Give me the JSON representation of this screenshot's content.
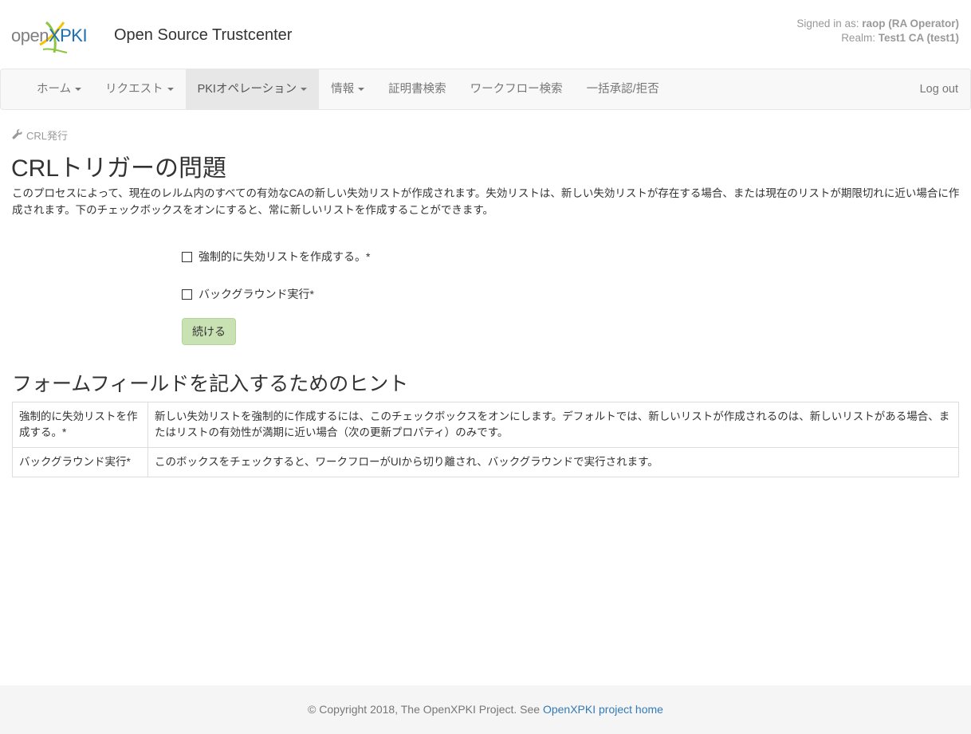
{
  "header": {
    "logo": {
      "part1": "open",
      "part2": "XPKI"
    },
    "site_title": "Open Source Trustcenter",
    "user": {
      "signed_in_label": "Signed in as:",
      "signed_in_value": "raop (RA Operator)",
      "realm_label": "Realm:",
      "realm_value": "Test1 CA (test1)"
    }
  },
  "nav": {
    "items": [
      {
        "label": "ホーム",
        "dropdown": true
      },
      {
        "label": "リクエスト",
        "dropdown": true
      },
      {
        "label": "PKIオペレーション",
        "dropdown": true,
        "active": true
      },
      {
        "label": "情報",
        "dropdown": true
      },
      {
        "label": "証明書検索",
        "dropdown": false
      },
      {
        "label": "ワークフロー検索",
        "dropdown": false
      },
      {
        "label": "一括承認/拒否",
        "dropdown": false
      }
    ],
    "logout": "Log out"
  },
  "breadcrumb": {
    "icon": "wrench-icon",
    "label": "CRL発行"
  },
  "page": {
    "title": "CRLトリガーの問題",
    "description": "このプロセスによって、現在のレルム内のすべての有効なCAの新しい失効リストが作成されます。失効リストは、新しい失効リストが存在する場合、または現在のリストが期限切れに近い場合に作成されます。下のチェックボックスをオンにすると、常に新しいリストを作成することができます。"
  },
  "form": {
    "force_label": "強制的に失効リストを作成する。*",
    "force_checked": false,
    "background_label": "バックグラウンド実行*",
    "background_checked": false,
    "submit_label": "続ける"
  },
  "hints": {
    "title": "フォームフィールドを記入するためのヒント",
    "rows": [
      {
        "field": "強制的に失効リストを作成する。*",
        "hint": "新しい失効リストを強制的に作成するには、このチェックボックスをオンにします。デフォルトでは、新しいリストが作成されるのは、新しいリストがある場合、またはリストの有効性が満期に近い場合（次の更新プロパティ）のみです。"
      },
      {
        "field": "バックグラウンド実行*",
        "hint": "このボックスをチェックすると、ワークフローがUIから切り離され、バックグラウンドで実行されます。"
      }
    ]
  },
  "footer": {
    "text": "© Copyright 2018, The OpenXPKI Project. See ",
    "link": "OpenXPKI project home"
  },
  "colors": {
    "brand_blue": "#1c6fb4",
    "brand_green": "#8dc63f",
    "brand_yellow": "#f2c500",
    "link": "#337ab7",
    "button_success_light": "#c9e2b3"
  }
}
